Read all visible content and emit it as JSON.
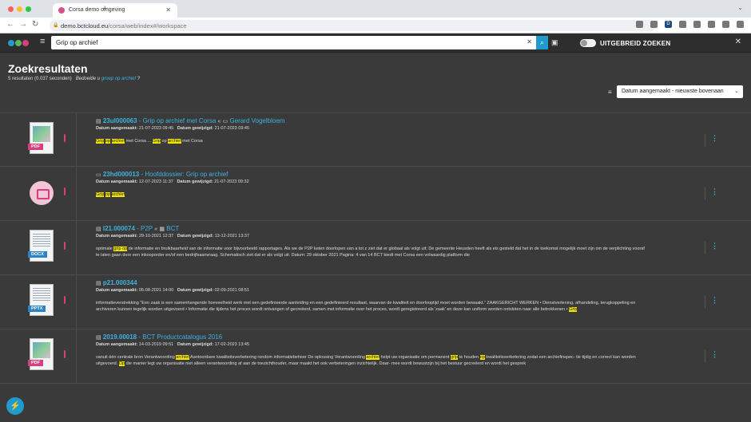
{
  "browser": {
    "tab_title": "Corsa demo omgeving",
    "url_domain": "demo.bctcloud.eu",
    "url_path": "/corsa/web/index#/workspace",
    "ext_d": "D"
  },
  "app": {
    "search_value": "Grip op archief",
    "advanced_label": "UITGEBREID ZOEKEN"
  },
  "header": {
    "title": "Zoekresultaten",
    "count_text": "5 resultaten (0.037 seconden)",
    "suggest_prefix": "Bedoelde u",
    "suggest_link": "groep op archief",
    "suggest_suffix": "?"
  },
  "sort": {
    "selected": "Datum aangemaakt - nieuwste bovenaan"
  },
  "results": [
    {
      "id": "23ul000063",
      "title": "Grip op archief met Corsa",
      "linked": "Gerard Vogelbloem",
      "badge": "PDF",
      "created_label": "Datum aangemaakt:",
      "created": "21-07-2023 09:45",
      "modified_label": "Datum gewijzigd:",
      "modified": "21-07-2023 09:45"
    },
    {
      "id": "23hd000013",
      "title": "Hoofddossier: Grip op archief",
      "created_label": "Datum aangemaakt:",
      "created": "12-07-2023 11:37",
      "modified_label": "Datum gewijzigd:",
      "modified": "21-07-2023 09:32"
    },
    {
      "id": "l21.000074",
      "title": "P2P",
      "linked": "BCT",
      "badge": "DOCX",
      "created_label": "Datum aangemaakt:",
      "created": "29-10-2021 12:37",
      "modified_label": "Datum gewijzigd:",
      "modified": "13-12-2021 13:37"
    },
    {
      "id": "p21.000344",
      "badge": "PPTX",
      "created_label": "Datum aangemaakt:",
      "created": "05-08-2021 14:00",
      "modified_label": "Datum gewijzigd:",
      "modified": "02-09-2021 08:51"
    },
    {
      "id": "2019.00018",
      "title": "BCT Productcatalogus 2016",
      "badge": "PDF",
      "created_label": "Datum aangemaakt:",
      "created": "14-03-2019 09:51",
      "modified_label": "Datum gewijzigd:",
      "modified": "17-02-2023 13:45"
    }
  ],
  "snippets": {
    "r1": [
      "Grip",
      " ",
      "op",
      " ",
      "archief",
      " met Corsa ... ",
      "Grip",
      " op ",
      "archief",
      " met Corsa"
    ],
    "r2": [
      "Grip",
      " ",
      "op",
      " ",
      "archief"
    ],
    "r3": [
      "optimale ",
      "grip op",
      " de informatie en bruikbaarheid van de informatie voor bijvoorbeeld rapportages. Als we de P2P keten doorlopen van a tot z ziet dat er globaal als volgt uit; De gemeente Heusden heeft als eis gesteld dat het in de toekomst mogelijk moet zijn om de verplichting vooraf te laten gaan door een inkooporder en/of een bedrijfsaanvraag. Schematisch ziet dat er als volgt uit: Datum: 29 oktober 2021 Pagina: 4 van 14 BCT biedt met Corsa een volwaardig platform die"
    ],
    "r4": [
      "informatieverstrekking \"Een zaak is een samenhangende hoeveelheid werk met een gedefinieerde aanleiding en een gedefinieerd resultaat, waarvan de kwaliteit en doorlooptijd moet worden bewaakt.\" ZAAKGERICHT WERKEN • Dienstverlening, afhandeling, terugkoppeling en archiveren kunnen tegelijk worden uitgevoerd • Informatie die tijdens het proces wordt ontvangen of gecreëerd, samen met informatie over het proces, wordt geregistreerd als 'zaak' en deze kan uniform worden ontsloten naar alle betrokkenen • ",
      "Grip",
      ""
    ],
    "r5": [
      "vanuit één centrale bron Verantwoording ",
      "archief",
      " Aantoonbare kwaliteitsverbetering rondom informatiebeheer De oplossing Verantwoording ",
      "archief",
      " helpt uw organisatie om permanent ",
      "grip",
      " te houden ",
      "op",
      " kwaliteitsverbetering zodat een archiefinspec- tie tijdig en correct kan worden uitgevoerd. ",
      "Op",
      " die manier legt uw organisatie niet alleen verantwoording af aan de toezichthouder, maar maakt het ook verbeteringen inzichtelijk. Daar- mee wordt bewustzijn bij het bestuur gecreëerd en wordt het gesprek"
    ]
  },
  "icons": {
    "logo_colors": [
      "#1f9ccd",
      "#5cb85c",
      "#d93f7e"
    ],
    "accent": "#1f9ccd",
    "highlight": "#f2e500",
    "pdf_badge": "#d93f7e",
    "office_badge": "#2b84c6"
  }
}
